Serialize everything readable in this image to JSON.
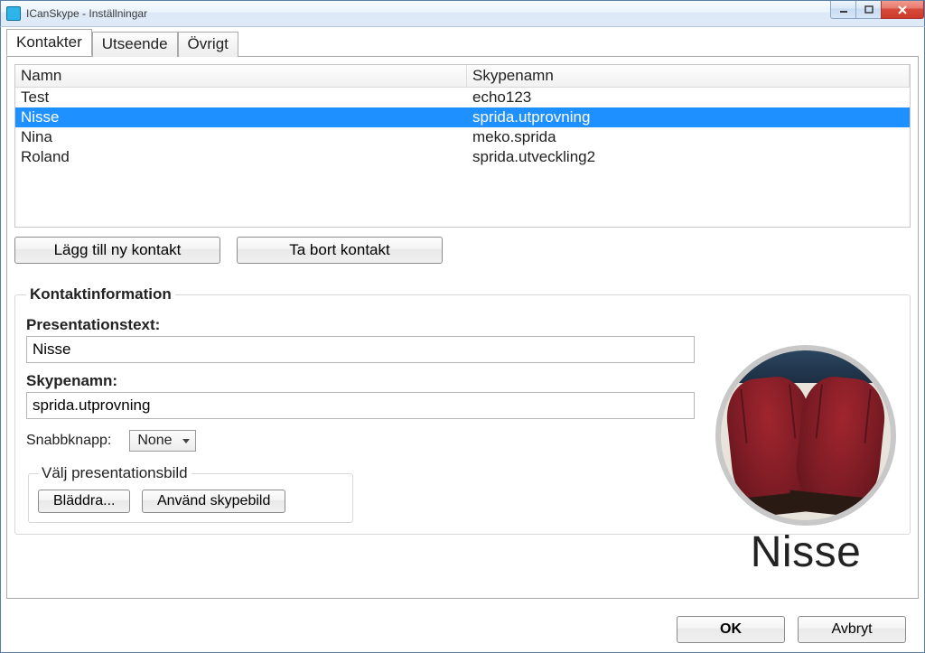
{
  "window": {
    "title": "ICanSkype - Inställningar"
  },
  "tabs": {
    "contacts": "Kontakter",
    "appearance": "Utseende",
    "other": "Övrigt"
  },
  "grid": {
    "headers": {
      "name": "Namn",
      "skype": "Skypenamn"
    },
    "rows": [
      {
        "name": "Test",
        "skype": "echo123",
        "selected": false
      },
      {
        "name": "Nisse",
        "skype": "sprida.utprovning",
        "selected": true
      },
      {
        "name": "Nina",
        "skype": "meko.sprida",
        "selected": false
      },
      {
        "name": "Roland",
        "skype": "sprida.utveckling2",
        "selected": false
      }
    ]
  },
  "buttons": {
    "add": "Lägg till ny kontakt",
    "remove": "Ta bort kontakt",
    "browse": "Bläddra...",
    "use_skype": "Använd skypebild",
    "ok": "OK",
    "cancel": "Avbryt"
  },
  "group": {
    "legend": "Kontaktinformation",
    "presentation_label": "Presentationstext:",
    "presentation_value": "Nisse",
    "skypename_label": "Skypenamn:",
    "skypename_value": "sprida.utprovning",
    "hotkey_label": "Snabbknapp:",
    "hotkey_value": "None",
    "image_legend": "Välj presentationsbild"
  },
  "avatar": {
    "name": "Nisse"
  }
}
